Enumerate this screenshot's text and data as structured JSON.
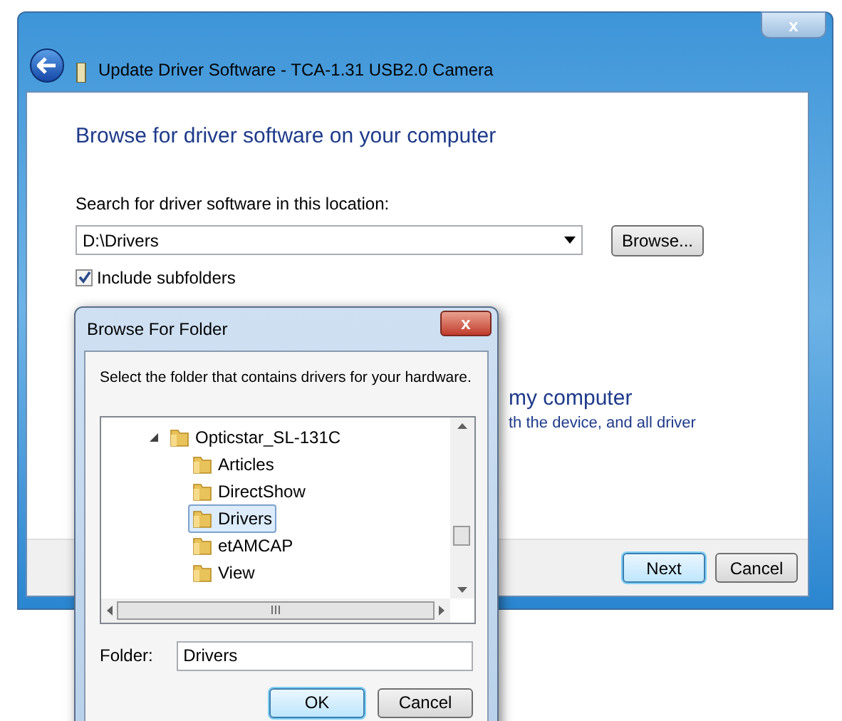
{
  "window": {
    "title": "Update Driver Software - TCA-1.31 USB2.0 Camera",
    "close": "x"
  },
  "heading": "Browse for driver software on your computer",
  "location_label": "Search for driver software in this location:",
  "location_field": {
    "value": "D:\\Drivers"
  },
  "browse_button": "Browse...",
  "include_subfolders": {
    "label": "Include subfolders",
    "checked": true
  },
  "hidden_option": {
    "title": "my computer",
    "description": "th the device, and all driver"
  },
  "buttons": [
    {
      "label": "Next",
      "default": true
    },
    {
      "label": "Cancel",
      "default": false
    }
  ],
  "dialog": {
    "title": "Browse For Folder",
    "close": "x",
    "instruction": "Select the folder that contains drivers for your hardware.",
    "tree": [
      {
        "label": "Opticstar_SL-131C",
        "expanded": true,
        "selected": false,
        "children": [
          {
            "label": "Articles",
            "selected": false
          },
          {
            "label": "DirectShow",
            "selected": false
          },
          {
            "label": "Drivers",
            "selected": true
          },
          {
            "label": "etAMCAP",
            "selected": false
          },
          {
            "label": "View",
            "selected": false
          }
        ]
      }
    ],
    "folder_label": "Folder:",
    "folder_field": {
      "value": "Drivers"
    },
    "buttons": [
      {
        "label": "OK",
        "default": true
      },
      {
        "label": "Cancel",
        "default": false
      }
    ]
  }
}
